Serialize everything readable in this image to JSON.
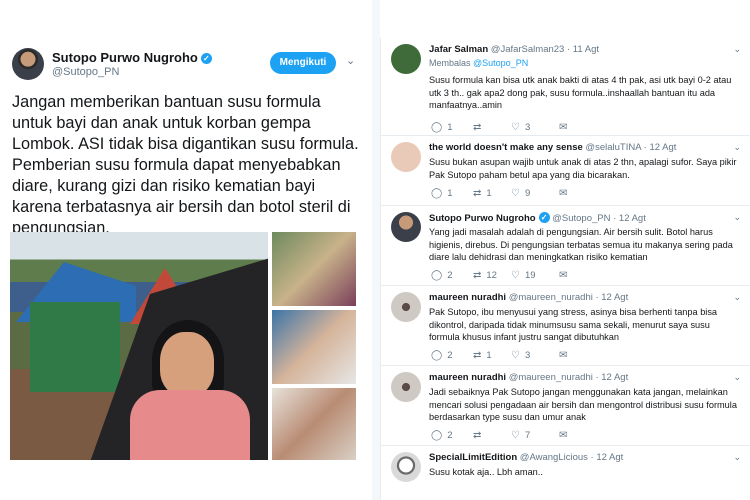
{
  "main_tweet": {
    "author_name": "Sutopo Purwo Nugroho",
    "handle": "@Sutopo_PN",
    "follow_label": "Mengikuti",
    "text": "Jangan memberikan bantuan susu formula untuk bayi dan anak untuk korban gempa Lombok. ASI tidak bisa digantikan susu formula. Pemberian susu formula dapat menyebabkan diare, kurang gizi dan risiko kematian bayi karena terbatasnya air bersih dan botol steril di pengungsian."
  },
  "replies": [
    {
      "name": "Jafar Salman",
      "meta": "@JafarSalman23 · 11 Agt",
      "replying_prefix": "Membalas",
      "replying_to": "@Sutopo_PN",
      "text": "Susu formula kan bisa utk anak bakti di atas 4 th pak, asi utk bayi 0-2 atau utk 3 th.. gak apa2 dong pak, susu formula..inshaallah bantuan itu ada manfaatnya..amin",
      "counts": {
        "reply": "1",
        "retweet": "",
        "like": "3"
      },
      "avatar_color": "#3f6b3a"
    },
    {
      "name": "the world doesn't make any sense",
      "meta": "@selaluTINA · 12 Agt",
      "text": "Susu bukan asupan wajib untuk anak di atas 2 thn, apalagi sufor. Saya pikir Pak Sutopo paham betul apa yang dia bicarakan.",
      "counts": {
        "reply": "1",
        "retweet": "1",
        "like": "9"
      },
      "avatar_color": "#e9c9b8"
    },
    {
      "name": "Sutopo Purwo Nugroho",
      "meta": "@Sutopo_PN · 12 Agt",
      "text": "Yang jadi masalah adalah di pengungsian. Air bersih sulit. Botol harus higienis, direbus. Di pengungsian terbatas semua itu makanya sering pada diare lalu dehidrasi dan meningkatkan risiko kematian",
      "counts": {
        "reply": "2",
        "retweet": "12",
        "like": "19"
      },
      "avatar_color": "#3a3f4a"
    },
    {
      "name": "maureen nuradhi",
      "meta": "@maureen_nuradhi · 12 Agt",
      "text": "Pak Sutopo, ibu menyusui yang stress, asinya bisa berhenti tanpa bisa dikontrol, daripada tidak minumsusu sama sekali, menurut saya susu formula khusus infant justru sangat dibutuhkan",
      "counts": {
        "reply": "2",
        "retweet": "1",
        "like": "3"
      },
      "avatar_color": "#cfc9c4"
    },
    {
      "name": "maureen nuradhi",
      "meta": "@maureen_nuradhi · 12 Agt",
      "text": "Jadi sebaiknya Pak Sutopo jangan menggunakan kata jangan, melainkan mencari solusi pengadaan air bersih dan mengontrol distribusi susu formula berdasarkan type susu dan umur anak",
      "counts": {
        "reply": "2",
        "retweet": "",
        "like": "7"
      },
      "avatar_color": "#cfc9c4"
    },
    {
      "name": "SpecialLimitEdition",
      "meta": "@AwangLicious · 12 Agt",
      "text": "Susu kotak aja..  Lbh aman..",
      "counts": {
        "reply": "",
        "retweet": "",
        "like": ""
      },
      "avatar_color": "#d9d9d9"
    }
  ],
  "icons": {
    "reply": "reply-icon",
    "retweet": "retweet-icon",
    "like": "heart-icon",
    "dm": "envelope-icon",
    "verified": "verified-badge-icon",
    "chevron": "chevron-down-icon"
  },
  "colors": {
    "accent": "#1da1f2",
    "muted": "#657786",
    "text": "#14171a"
  }
}
